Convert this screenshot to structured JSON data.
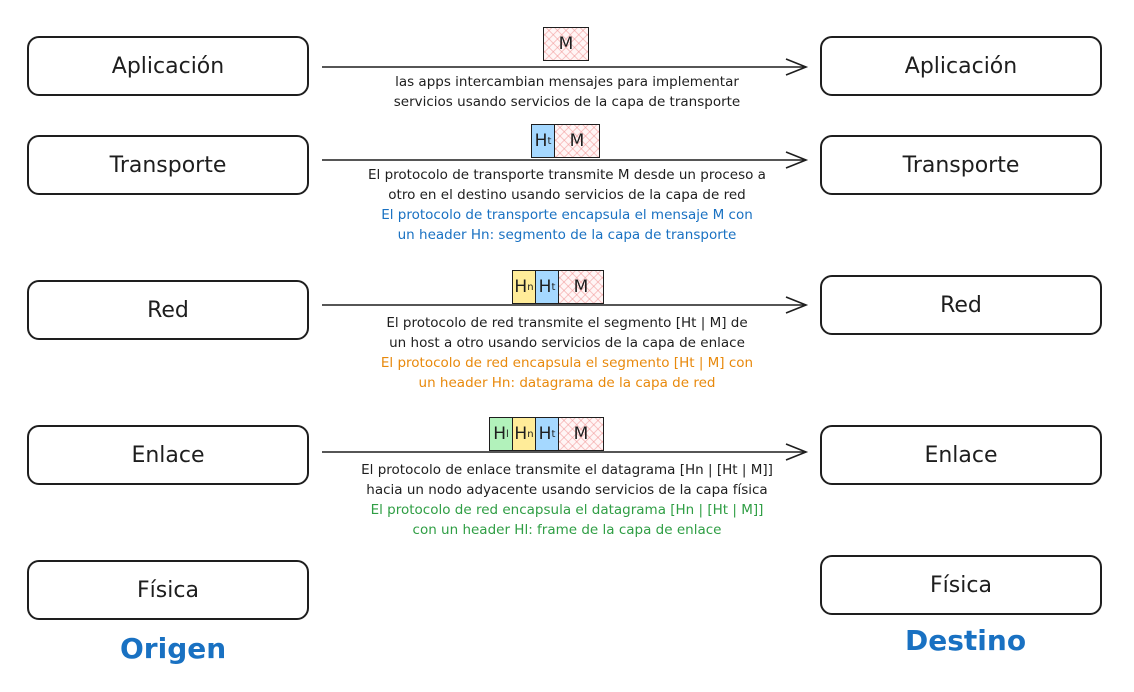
{
  "layers": {
    "app": {
      "label": "Aplicación"
    },
    "transport": {
      "label": "Transporte"
    },
    "network": {
      "label": "Red"
    },
    "link": {
      "label": "Enlace"
    },
    "physical": {
      "label": "Física"
    }
  },
  "packets": {
    "message": "M",
    "ht": {
      "base": "H",
      "sub": "t"
    },
    "hn": {
      "base": "H",
      "sub": "n"
    },
    "hl": {
      "base": "H",
      "sub": "l"
    }
  },
  "captions": {
    "app": {
      "line1": "las apps intercambian mensajes para implementar",
      "line2": "servicios usando servicios de la capa de transporte"
    },
    "transport": {
      "line1": "El protocolo de transporte transmite M desde un proceso a",
      "line2": "otro en el destino usando servicios de la capa de red",
      "note1": "El protocolo de transporte encapsula el mensaje M con",
      "note2": "un header Hn: segmento de la capa de transporte"
    },
    "network": {
      "line1": "El protocolo de red transmite el segmento [Ht | M] de",
      "line2": "un host a otro usando servicios de la capa de enlace",
      "note1": "El protocolo de red encapsula el segmento [Ht | M] con",
      "note2": "un header Hn: datagrama de la capa de red"
    },
    "link": {
      "line1": "El protocolo de enlace transmite el datagrama [Hn | [Ht | M]]",
      "line2": "hacia un nodo adyacente usando servicios de la capa física",
      "note1": "El protocolo de red encapsula el datagrama [Hn | [Ht | M]]",
      "note2": "con un header Hl: frame de la capa de enlace"
    }
  },
  "footer": {
    "origin": "Origen",
    "destination": "Destino"
  },
  "colors": {
    "accent_blue": "#1971c2",
    "note_orange": "#e8890c",
    "note_green": "#2f9e44",
    "header_t": "#a5d8ff",
    "header_n": "#ffec99",
    "header_l": "#b2f2bb",
    "message_fill": "#fff5f5"
  }
}
